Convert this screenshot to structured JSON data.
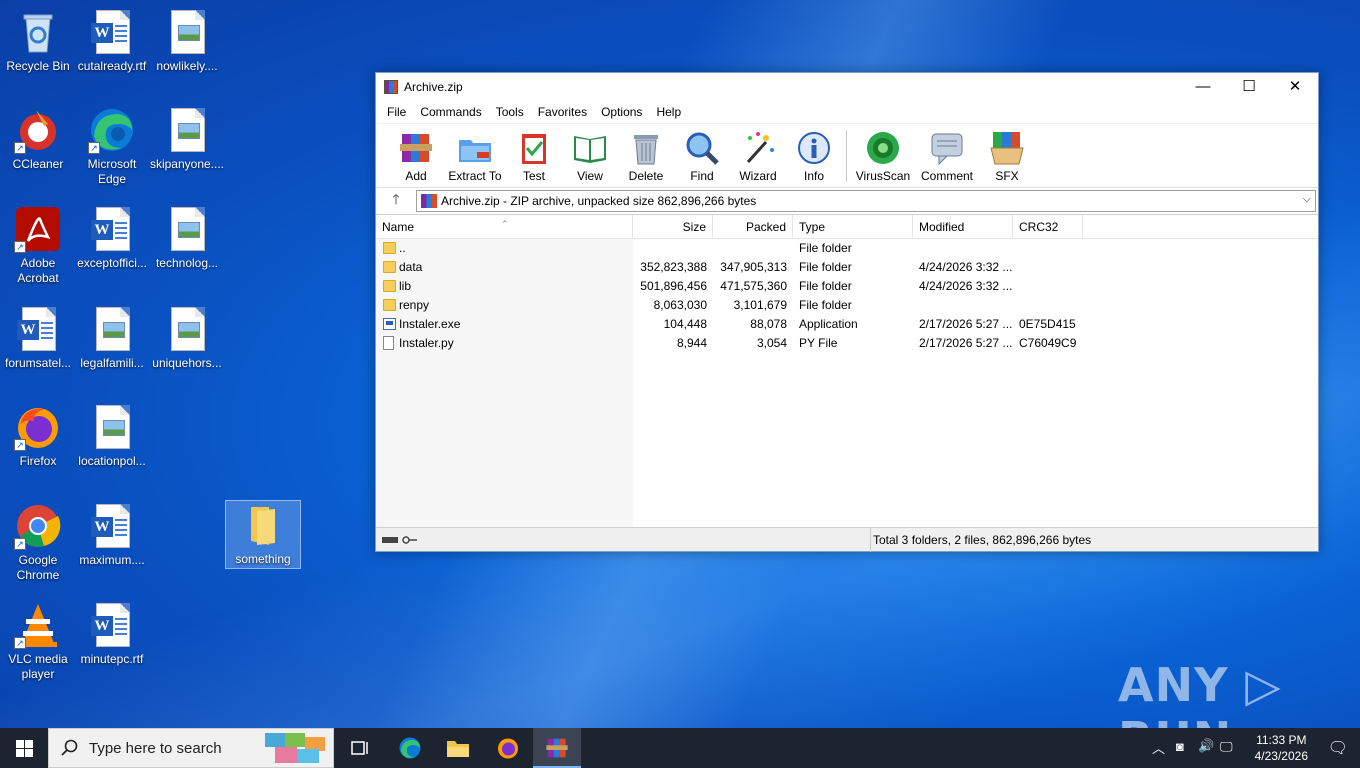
{
  "desktop": {
    "icons": [
      {
        "label": "Recycle Bin"
      },
      {
        "label": "cutalready.rtf"
      },
      {
        "label": "nowlikely...."
      },
      {
        "label": "CCleaner"
      },
      {
        "label": "Microsoft Edge"
      },
      {
        "label": "skipanyone...."
      },
      {
        "label": "Adobe Acrobat"
      },
      {
        "label": "exceptoffici..."
      },
      {
        "label": "technolog..."
      },
      {
        "label": "forumsatel..."
      },
      {
        "label": "legalfamili..."
      },
      {
        "label": "uniquehors..."
      },
      {
        "label": "Firefox"
      },
      {
        "label": "locationpol..."
      },
      {
        "label": "Google Chrome"
      },
      {
        "label": "maximum...."
      },
      {
        "label": "something"
      },
      {
        "label": "VLC media player"
      },
      {
        "label": "minutepc.rtf"
      }
    ]
  },
  "window": {
    "title": "Archive.zip",
    "menu": [
      "File",
      "Commands",
      "Tools",
      "Favorites",
      "Options",
      "Help"
    ],
    "toolbar": [
      "Add",
      "Extract To",
      "Test",
      "View",
      "Delete",
      "Find",
      "Wizard",
      "Info",
      "VirusScan",
      "Comment",
      "SFX"
    ],
    "address": "Archive.zip - ZIP archive, unpacked size 862,896,266 bytes",
    "columns": {
      "name": "Name",
      "size": "Size",
      "packed": "Packed",
      "type": "Type",
      "modified": "Modified",
      "crc": "CRC32"
    },
    "rows": [
      {
        "name": "..",
        "size": "",
        "packed": "",
        "type": "File folder",
        "modified": "",
        "crc": "",
        "icon": "folder"
      },
      {
        "name": "data",
        "size": "352,823,388",
        "packed": "347,905,313",
        "type": "File folder",
        "modified": "4/24/2026 3:32 ...",
        "crc": "",
        "icon": "folder"
      },
      {
        "name": "lib",
        "size": "501,896,456",
        "packed": "471,575,360",
        "type": "File folder",
        "modified": "4/24/2026 3:32 ...",
        "crc": "",
        "icon": "folder"
      },
      {
        "name": "renpy",
        "size": "8,063,030",
        "packed": "3,101,679",
        "type": "File folder",
        "modified": "",
        "crc": "",
        "icon": "folder"
      },
      {
        "name": "Instaler.exe",
        "size": "104,448",
        "packed": "88,078",
        "type": "Application",
        "modified": "2/17/2026 5:27 ...",
        "crc": "0E75D415",
        "icon": "exe"
      },
      {
        "name": "Instaler.py",
        "size": "8,944",
        "packed": "3,054",
        "type": "PY File",
        "modified": "2/17/2026 5:27 ...",
        "crc": "C76049C9",
        "icon": "py"
      }
    ],
    "status": "Total 3 folders, 2 files, 862,896,266 bytes"
  },
  "taskbar": {
    "search_placeholder": "Type here to search",
    "time": "11:33 PM",
    "date": "4/23/2026"
  },
  "watermark": "ANY ▷ RUN"
}
